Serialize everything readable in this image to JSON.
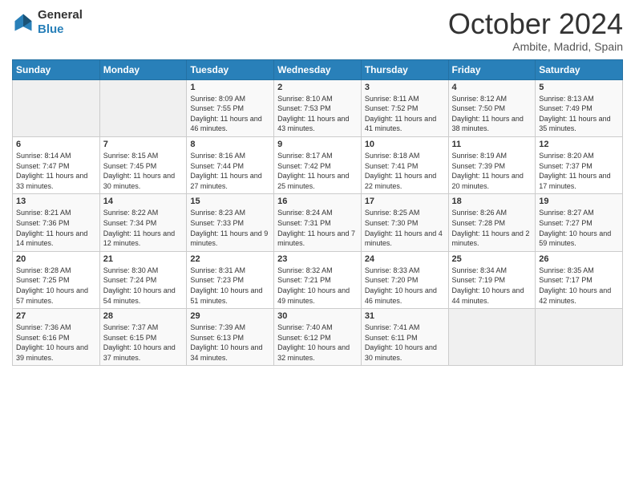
{
  "header": {
    "logo_line1": "General",
    "logo_line2": "Blue",
    "month": "October 2024",
    "location": "Ambite, Madrid, Spain"
  },
  "days_of_week": [
    "Sunday",
    "Monday",
    "Tuesday",
    "Wednesday",
    "Thursday",
    "Friday",
    "Saturday"
  ],
  "weeks": [
    [
      {
        "num": "",
        "info": ""
      },
      {
        "num": "",
        "info": ""
      },
      {
        "num": "1",
        "info": "Sunrise: 8:09 AM\nSunset: 7:55 PM\nDaylight: 11 hours and 46 minutes."
      },
      {
        "num": "2",
        "info": "Sunrise: 8:10 AM\nSunset: 7:53 PM\nDaylight: 11 hours and 43 minutes."
      },
      {
        "num": "3",
        "info": "Sunrise: 8:11 AM\nSunset: 7:52 PM\nDaylight: 11 hours and 41 minutes."
      },
      {
        "num": "4",
        "info": "Sunrise: 8:12 AM\nSunset: 7:50 PM\nDaylight: 11 hours and 38 minutes."
      },
      {
        "num": "5",
        "info": "Sunrise: 8:13 AM\nSunset: 7:49 PM\nDaylight: 11 hours and 35 minutes."
      }
    ],
    [
      {
        "num": "6",
        "info": "Sunrise: 8:14 AM\nSunset: 7:47 PM\nDaylight: 11 hours and 33 minutes."
      },
      {
        "num": "7",
        "info": "Sunrise: 8:15 AM\nSunset: 7:45 PM\nDaylight: 11 hours and 30 minutes."
      },
      {
        "num": "8",
        "info": "Sunrise: 8:16 AM\nSunset: 7:44 PM\nDaylight: 11 hours and 27 minutes."
      },
      {
        "num": "9",
        "info": "Sunrise: 8:17 AM\nSunset: 7:42 PM\nDaylight: 11 hours and 25 minutes."
      },
      {
        "num": "10",
        "info": "Sunrise: 8:18 AM\nSunset: 7:41 PM\nDaylight: 11 hours and 22 minutes."
      },
      {
        "num": "11",
        "info": "Sunrise: 8:19 AM\nSunset: 7:39 PM\nDaylight: 11 hours and 20 minutes."
      },
      {
        "num": "12",
        "info": "Sunrise: 8:20 AM\nSunset: 7:37 PM\nDaylight: 11 hours and 17 minutes."
      }
    ],
    [
      {
        "num": "13",
        "info": "Sunrise: 8:21 AM\nSunset: 7:36 PM\nDaylight: 11 hours and 14 minutes."
      },
      {
        "num": "14",
        "info": "Sunrise: 8:22 AM\nSunset: 7:34 PM\nDaylight: 11 hours and 12 minutes."
      },
      {
        "num": "15",
        "info": "Sunrise: 8:23 AM\nSunset: 7:33 PM\nDaylight: 11 hours and 9 minutes."
      },
      {
        "num": "16",
        "info": "Sunrise: 8:24 AM\nSunset: 7:31 PM\nDaylight: 11 hours and 7 minutes."
      },
      {
        "num": "17",
        "info": "Sunrise: 8:25 AM\nSunset: 7:30 PM\nDaylight: 11 hours and 4 minutes."
      },
      {
        "num": "18",
        "info": "Sunrise: 8:26 AM\nSunset: 7:28 PM\nDaylight: 11 hours and 2 minutes."
      },
      {
        "num": "19",
        "info": "Sunrise: 8:27 AM\nSunset: 7:27 PM\nDaylight: 10 hours and 59 minutes."
      }
    ],
    [
      {
        "num": "20",
        "info": "Sunrise: 8:28 AM\nSunset: 7:25 PM\nDaylight: 10 hours and 57 minutes."
      },
      {
        "num": "21",
        "info": "Sunrise: 8:30 AM\nSunset: 7:24 PM\nDaylight: 10 hours and 54 minutes."
      },
      {
        "num": "22",
        "info": "Sunrise: 8:31 AM\nSunset: 7:23 PM\nDaylight: 10 hours and 51 minutes."
      },
      {
        "num": "23",
        "info": "Sunrise: 8:32 AM\nSunset: 7:21 PM\nDaylight: 10 hours and 49 minutes."
      },
      {
        "num": "24",
        "info": "Sunrise: 8:33 AM\nSunset: 7:20 PM\nDaylight: 10 hours and 46 minutes."
      },
      {
        "num": "25",
        "info": "Sunrise: 8:34 AM\nSunset: 7:19 PM\nDaylight: 10 hours and 44 minutes."
      },
      {
        "num": "26",
        "info": "Sunrise: 8:35 AM\nSunset: 7:17 PM\nDaylight: 10 hours and 42 minutes."
      }
    ],
    [
      {
        "num": "27",
        "info": "Sunrise: 7:36 AM\nSunset: 6:16 PM\nDaylight: 10 hours and 39 minutes."
      },
      {
        "num": "28",
        "info": "Sunrise: 7:37 AM\nSunset: 6:15 PM\nDaylight: 10 hours and 37 minutes."
      },
      {
        "num": "29",
        "info": "Sunrise: 7:39 AM\nSunset: 6:13 PM\nDaylight: 10 hours and 34 minutes."
      },
      {
        "num": "30",
        "info": "Sunrise: 7:40 AM\nSunset: 6:12 PM\nDaylight: 10 hours and 32 minutes."
      },
      {
        "num": "31",
        "info": "Sunrise: 7:41 AM\nSunset: 6:11 PM\nDaylight: 10 hours and 30 minutes."
      },
      {
        "num": "",
        "info": ""
      },
      {
        "num": "",
        "info": ""
      }
    ]
  ]
}
